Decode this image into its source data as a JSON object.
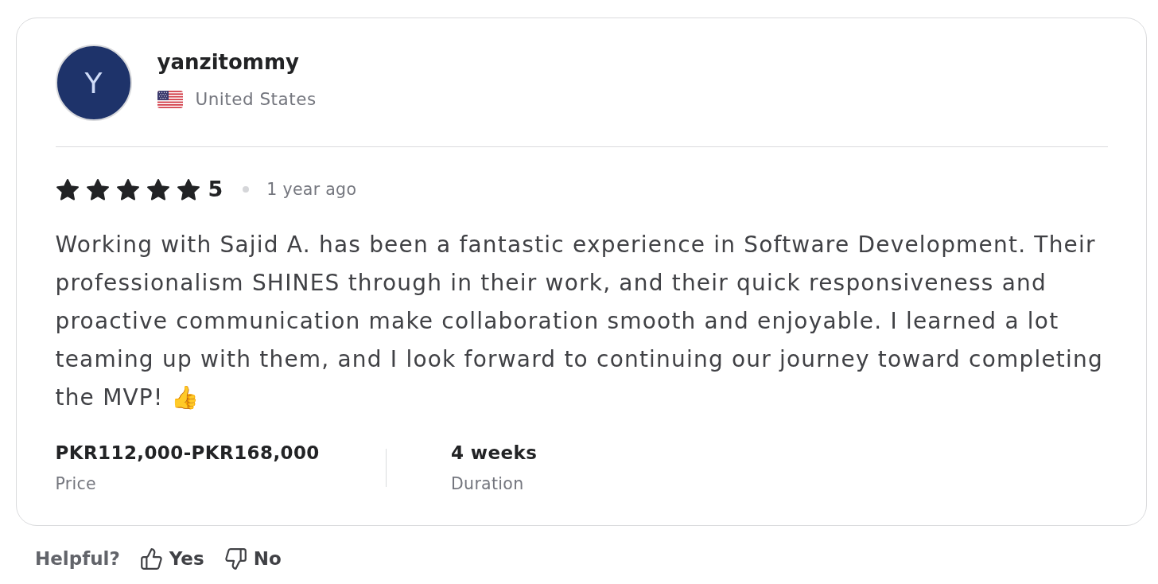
{
  "reviewer": {
    "initial": "Y",
    "name": "yanzitommy",
    "country": "United States"
  },
  "rating": {
    "stars": 5,
    "score": "5",
    "time": "1 year ago"
  },
  "review": {
    "text": "Working with Sajid A. has been a fantastic experience in Software Development. Their professionalism SHINES through in their work, and their quick responsiveness and proactive communication make collaboration smooth and enjoyable. I learned a lot teaming up with them, and I look forward to continuing our journey toward completing the MVP! 👍"
  },
  "details": [
    {
      "value": "PKR112,000-PKR168,000",
      "label": "Price"
    },
    {
      "value": "4 weeks",
      "label": "Duration"
    }
  ],
  "feedback": {
    "prompt": "Helpful?",
    "buttons": [
      {
        "kind": "up",
        "label": "Yes"
      },
      {
        "kind": "down",
        "label": "No"
      }
    ]
  }
}
